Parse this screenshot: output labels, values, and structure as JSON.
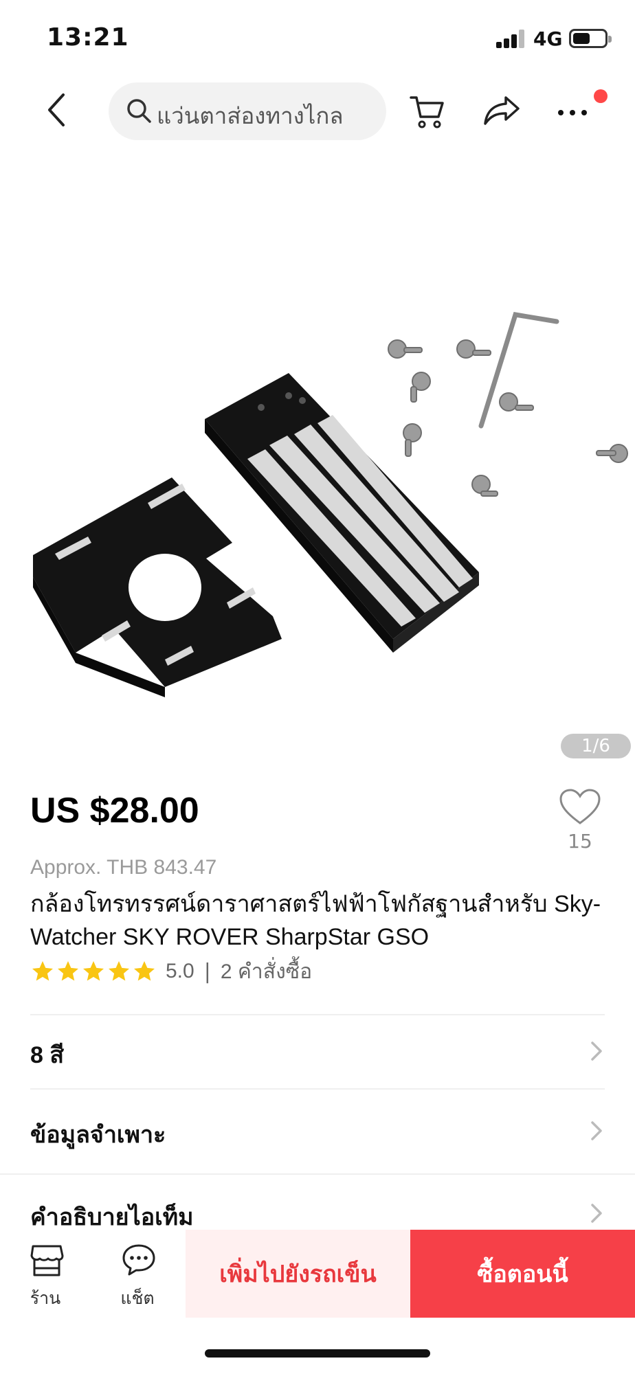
{
  "status_bar": {
    "time": "13:21",
    "network": "4G",
    "battery_level": 0.55
  },
  "header": {
    "search_placeholder": "แว่นตาส่องทางไกล",
    "accent_color": "#ff4848"
  },
  "gallery": {
    "counter": "1/6"
  },
  "product": {
    "price": "US $28.00",
    "approx_price": "Approx. THB 843.47",
    "title": "กล้องโทรทรรศน์ดาราศาสตร์ไฟฟ้าโฟกัสฐานสำหรับ Sky-Watcher SKY ROVER SharpStar GSO",
    "rating": "5.0",
    "rating_stars": 5,
    "rating_separator": "|",
    "orders": "2 คำสั่งซื้อ",
    "wishlist_count": "15",
    "star_color": "#f9c513"
  },
  "sections": [
    {
      "label": "8 สี"
    },
    {
      "label": "ข้อมูลจำเพาะ"
    },
    {
      "label": "คำอธิบายไอเท็ม"
    }
  ],
  "bottom_bar": {
    "store_label": "ร้าน",
    "chat_label": "แช็ต",
    "add_to_cart": "เพิ่มไปยังรถเข็น",
    "buy_now": "ซื้อตอนนี้",
    "buy_color": "#f64048"
  }
}
